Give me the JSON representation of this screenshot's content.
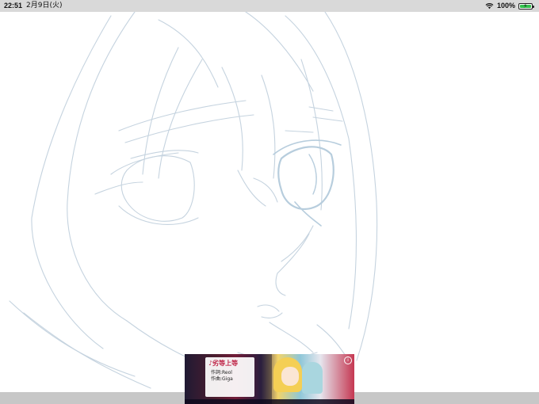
{
  "status_bar": {
    "time": "22:51",
    "date": "2月9日(火)",
    "battery_percent": "100%",
    "battery_level": 1.0,
    "icons": [
      "wifi-icon",
      "battery-charging-icon"
    ],
    "colors": {
      "background": "#d9d9d9",
      "battery_fill": "#33c24d"
    }
  },
  "canvas": {
    "content": "pencil sketch of a girl's face with bob hair",
    "stroke_color": "#c5d3df"
  },
  "ad_banner": {
    "song_title": "♪劣等上等",
    "lyrics_credit": "作詞:Reol",
    "music_credit": "作曲:Giga",
    "icon": "info-icon"
  }
}
